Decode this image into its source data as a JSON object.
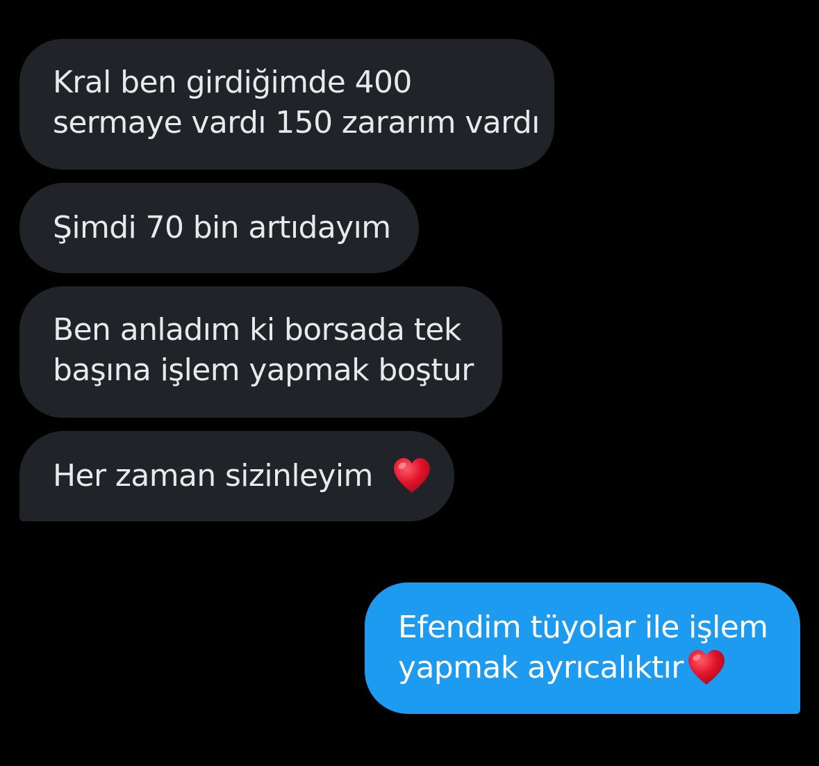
{
  "conversation": {
    "messages": [
      {
        "direction": "incoming",
        "lines": [
          "Kral ben girdiğimde 400",
          "sermaye vardı 150 zararım vardı"
        ]
      },
      {
        "direction": "incoming",
        "lines": [
          "Şimdi 70 bin artıdayım"
        ]
      },
      {
        "direction": "incoming",
        "lines": [
          "Ben anladım ki borsada tek",
          "başına işlem yapmak boştur"
        ]
      },
      {
        "direction": "incoming",
        "lines": [
          "Her zaman sizinleyim"
        ],
        "trailing_emoji": "red-heart"
      },
      {
        "direction": "outgoing",
        "lines": [
          "Efendim tüyolar ile işlem",
          "yapmak ayrıcalıktır"
        ],
        "trailing_emoji": "red-heart"
      }
    ]
  },
  "colors": {
    "background": "#000000",
    "incoming_bubble": "#202327",
    "incoming_text": "#e7e9ea",
    "outgoing_bubble": "#1d9bf0",
    "outgoing_text": "#ffffff",
    "heart": "#e0142c"
  }
}
